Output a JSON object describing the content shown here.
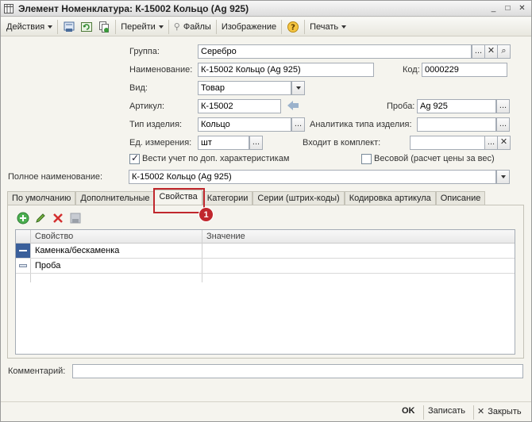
{
  "window": {
    "title": "Элемент Номенклатура: К-15002 Кольцо (Ag 925)",
    "controls": [
      "minimize-icon",
      "maximize-icon",
      "close-icon"
    ]
  },
  "toolbar": {
    "actions_label": "Действия",
    "goto_label": "Перейти",
    "files_label": "Файлы",
    "image_label": "Изображение",
    "print_label": "Печать"
  },
  "form": {
    "group_label": "Группа:",
    "group_value": "Серебро",
    "name_label": "Наименование:",
    "name_value": "К-15002 Кольцо (Ag 925)",
    "code_label": "Код:",
    "code_value": "0000229",
    "type_label": "Вид:",
    "type_value": "Товар",
    "article_label": "Артикул:",
    "article_value": "К-15002",
    "probe_label": "Проба:",
    "probe_value": "Ag 925",
    "item_type_label": "Тип изделия:",
    "item_type_value": "Кольцо",
    "item_type_analytics_label": "Аналитика типа изделия:",
    "item_type_analytics_value": "",
    "unit_label": "Ед. измерения:",
    "unit_value": "шт",
    "kit_label": "Входит в комплект:",
    "kit_value": "",
    "extra_chars_label": "Вести учет по доп. характеристикам",
    "extra_chars_checked": true,
    "weight_label": "Весовой (расчет цены за вес)",
    "weight_checked": false,
    "full_name_label": "Полное наименование:",
    "full_name_value": "К-15002 Кольцо (Ag 925)"
  },
  "tabs": [
    {
      "label": "По умолчанию",
      "active": false
    },
    {
      "label": "Дополнительные",
      "active": false
    },
    {
      "label": "Свойства",
      "active": true
    },
    {
      "label": "Категории",
      "active": false
    },
    {
      "label": "Серии (штрих-коды)",
      "active": false
    },
    {
      "label": "Кодировка артикула",
      "active": false
    },
    {
      "label": "Описание",
      "active": false
    }
  ],
  "properties_grid": {
    "headers": [
      "Свойство",
      "Значение"
    ],
    "rows": [
      {
        "property": "Каменка/бескаменка",
        "value": ""
      },
      {
        "property": "Проба",
        "value": ""
      }
    ]
  },
  "annotation": {
    "number": "1",
    "color": "#c0272d"
  },
  "comment": {
    "label": "Комментарий:",
    "value": ""
  },
  "footer": {
    "ok_label": "OK",
    "save_label": "Записать",
    "close_label": "Закрыть"
  },
  "colors": {
    "accent_blue": "#3a5f9a",
    "annotation_red": "#c0272d"
  }
}
